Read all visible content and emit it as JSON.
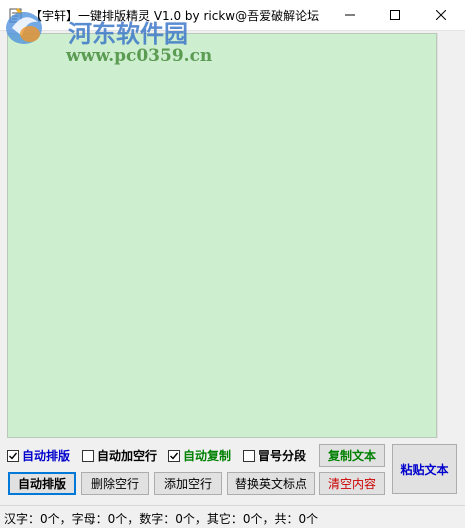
{
  "window": {
    "title": "【宇轩】一键排版精灵 V1.0 by rickw@吾爱破解论坛",
    "minimize_icon": "minimize-icon",
    "maximize_icon": "maximize-icon",
    "close_icon": "close-icon"
  },
  "watermark": {
    "site_name": "河东软件园",
    "site_url": "www.pc0359.cn"
  },
  "editor": {
    "content": "",
    "background_color": "#cdeecf"
  },
  "options": [
    {
      "label": "自动排版",
      "checked": true,
      "color": "#0000cc"
    },
    {
      "label": "自动加空行",
      "checked": false,
      "color": "#000000"
    },
    {
      "label": "自动复制",
      "checked": true,
      "color": "#008000"
    },
    {
      "label": "冒号分段",
      "checked": false,
      "color": "#000000"
    }
  ],
  "buttons": {
    "copy_text": {
      "label": "复制文本",
      "color": "#008000"
    },
    "paste_text": {
      "label": "粘贴文本",
      "color": "#0000cc"
    },
    "auto_format": {
      "label": "自动排版",
      "color": "#000000"
    },
    "delete_blank_lines": {
      "label": "删除空行",
      "color": "#000000"
    },
    "add_blank_lines": {
      "label": "添加空行",
      "color": "#000000"
    },
    "replace_punct": {
      "label": "替换英文标点",
      "color": "#000000"
    },
    "clear_content": {
      "label": "清空内容",
      "color": "#cc0000"
    }
  },
  "status": {
    "text": "汉字：0个，字母：0个，数字：0个，其它：0个，共：0个"
  }
}
